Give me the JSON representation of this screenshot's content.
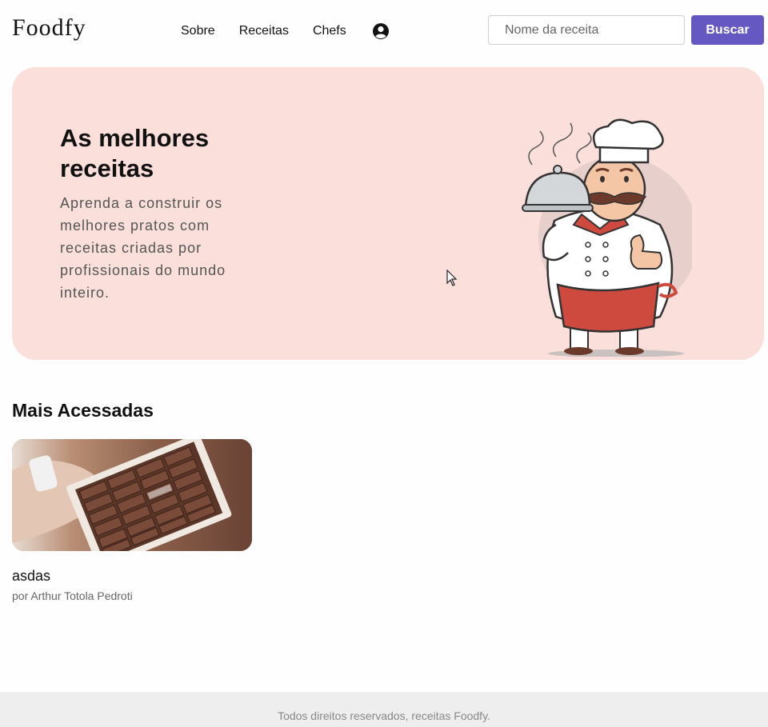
{
  "header": {
    "logo": "Foodfy",
    "nav": [
      {
        "label": "Sobre"
      },
      {
        "label": "Receitas"
      },
      {
        "label": "Chefs"
      }
    ],
    "user_icon": "user-circle-icon",
    "search": {
      "placeholder": "Nome da receita",
      "value": ""
    },
    "search_button": "Buscar"
  },
  "hero": {
    "title": "As melhores receitas",
    "text": "Aprenda a construir os melhores pratos com receitas criadas por profissionais do mundo inteiro.",
    "image": "chef-illustration"
  },
  "most_accessed": {
    "title": "Mais Acessadas",
    "cards": [
      {
        "title": "asdas",
        "author": "por Arthur Totola Pedroti",
        "image": "chocolate-box-photo"
      }
    ]
  },
  "footer": {
    "text": "Todos direitos reservados, receitas Foodfy."
  },
  "colors": {
    "accent": "#6558c3",
    "hero_bg": "#fbdfdb",
    "footer_bg": "#eeeeee"
  }
}
